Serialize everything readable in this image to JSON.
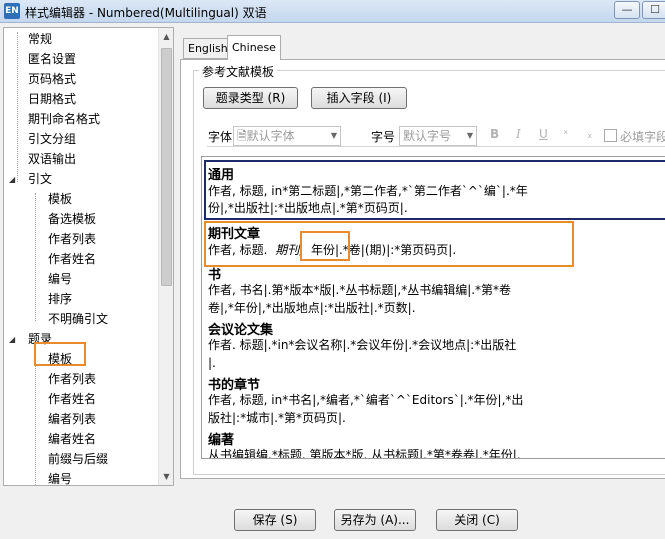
{
  "window": {
    "title": "样式编辑器 - Numbered(Multilingual) 双语",
    "app_icon": "EN",
    "minimize_symbol": "—",
    "maximize_symbol": "☐"
  },
  "tree": {
    "items": [
      {
        "label": "常规"
      },
      {
        "label": "匿名设置"
      },
      {
        "label": "页码格式"
      },
      {
        "label": "日期格式"
      },
      {
        "label": "期刊命名格式"
      },
      {
        "label": "引文分组"
      },
      {
        "label": "双语输出"
      },
      {
        "label": "引文",
        "expanded": true
      },
      {
        "label": "模板"
      },
      {
        "label": "备选模板"
      },
      {
        "label": "作者列表"
      },
      {
        "label": "作者姓名"
      },
      {
        "label": "编号"
      },
      {
        "label": "排序"
      },
      {
        "label": "不明确引文"
      },
      {
        "label": "题录",
        "expanded": true
      },
      {
        "label": "模板",
        "selected": true
      },
      {
        "label": "作者列表"
      },
      {
        "label": "作者姓名"
      },
      {
        "label": "编者列表"
      },
      {
        "label": "编者姓名"
      },
      {
        "label": "前缀与后缀"
      },
      {
        "label": "编号"
      }
    ],
    "expand_symbol": "◢"
  },
  "tabs": [
    {
      "label": "English",
      "active": false
    },
    {
      "label": "Chinese",
      "active": true
    }
  ],
  "template_group": {
    "label": "参考文献模板",
    "ref_type_button": "题录类型 (R)",
    "insert_field_button": "插入字段 (I)"
  },
  "format_bar": {
    "font_label": "字体",
    "font_value": "默认字体",
    "size_label": "字号",
    "size_value": "默认字号",
    "bold": "B",
    "italic": "I",
    "underline": "U",
    "superscript": "ˣ",
    "subscript": "ₓ",
    "required_field_label": "必填字段"
  },
  "templates": [
    {
      "heading": "通用",
      "lines": [
        "作者, 标题, in*第二标题|,*第二作者,*`第二作者`^`编`|.*年",
        "份|,*出版社|:*出版地点|.*第*页码页|."
      ]
    },
    {
      "heading": "期刊文章",
      "line_before": "作者, 标题.",
      "line_italic": "期刊,",
      "line_after": "年份|.*卷|(期)|:*第页码页|."
    },
    {
      "heading": "书",
      "lines": [
        "作者, 书名|.第*版本*版|.*丛书标题|,*丛书编辑编|.*第*卷",
        "卷|,*年份|,*出版地点|:*出版社|.*页数|."
      ]
    },
    {
      "heading": "会议论文集",
      "lines": [
        "作者. 标题|.*in*会议名称|.*会议年份|.*会议地点|:*出版社",
        "|."
      ]
    },
    {
      "heading": "书的章节",
      "lines": [
        "作者, 标题, in*书名|,*编者,*`编者`^`Editors`|.*年份|,*出",
        "版社|:*城市|.*第*页码页|."
      ]
    },
    {
      "heading": "编著",
      "lines": [
        "从书编辑编.*标题. 第版本*版. 从书标题|.*第*卷卷|.*年份|."
      ]
    }
  ],
  "buttons": {
    "save": "保存 (S)",
    "save_as": "另存为 (A)...",
    "close": "关闭 (C)"
  },
  "colors": {
    "highlight_orange": "#e98a2c",
    "frame_navy": "#1f2a6b",
    "title_bar": "#c4d7ee"
  }
}
